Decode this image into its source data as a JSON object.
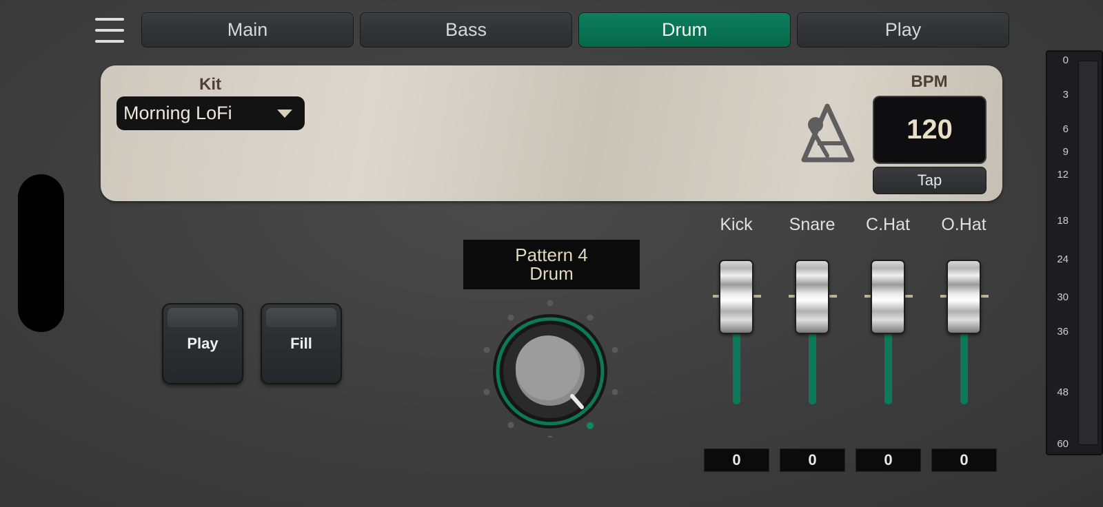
{
  "tabs": [
    {
      "label": "Main",
      "active": false
    },
    {
      "label": "Bass",
      "active": false
    },
    {
      "label": "Drum",
      "active": true
    },
    {
      "label": "Play",
      "active": false
    }
  ],
  "kit": {
    "label": "Kit",
    "selected": "Morning LoFi"
  },
  "tempo": {
    "label": "BPM",
    "value": "120",
    "tap_label": "Tap"
  },
  "pads": {
    "play_label": "Play",
    "fill_label": "Fill"
  },
  "pattern": {
    "line1": "Pattern 4",
    "line2": "Drum"
  },
  "mixer": [
    {
      "label": "Kick",
      "value": "0",
      "level": 0
    },
    {
      "label": "Snare",
      "value": "0",
      "level": 0
    },
    {
      "label": "C.Hat",
      "value": "0",
      "level": 0
    },
    {
      "label": "O.Hat",
      "value": "0",
      "level": 0
    }
  ],
  "meter_scale": [
    "0",
    "3",
    "6",
    "9",
    "12",
    "18",
    "24",
    "30",
    "36",
    "48",
    "60"
  ],
  "colors": {
    "accent": "#066e4e",
    "panel": "#d4cec4",
    "background": "#3f3f3f"
  }
}
